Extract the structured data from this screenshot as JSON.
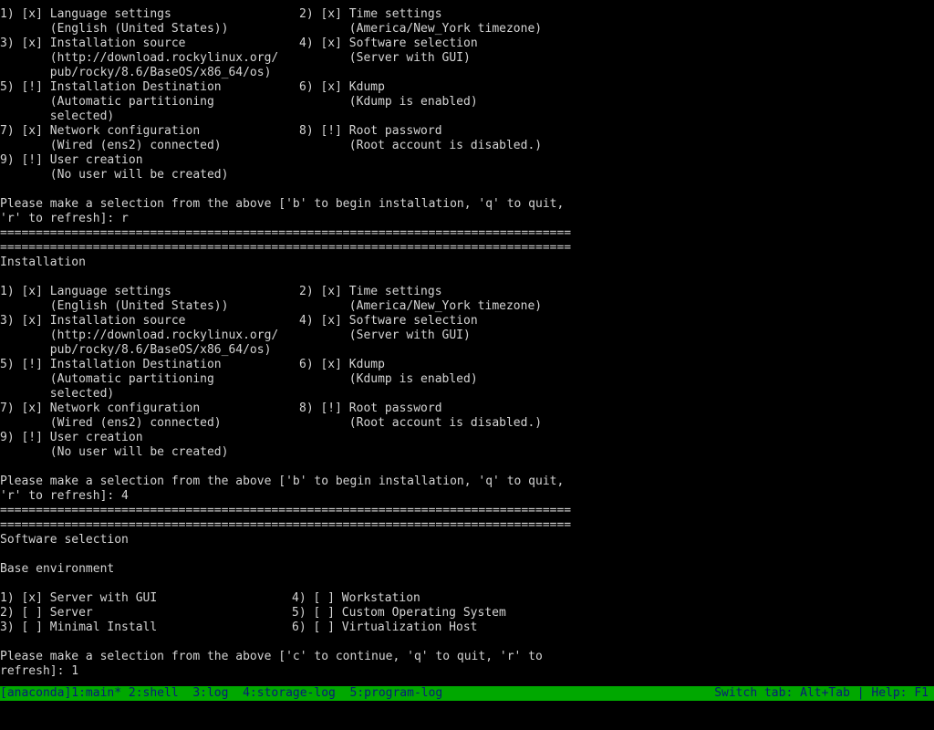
{
  "hub1": {
    "left": [
      "1) [x] Language settings",
      "       (English (United States))",
      "3) [x] Installation source",
      "       (http://download.rockylinux.org/",
      "       pub/rocky/8.6/BaseOS/x86_64/os)",
      "5) [!] Installation Destination",
      "       (Automatic partitioning",
      "       selected)",
      "7) [x] Network configuration",
      "       (Wired (ens2) connected)",
      "9) [!] User creation",
      "       (No user will be created)"
    ],
    "right": [
      "2) [x] Time settings",
      "       (America/New_York timezone)",
      "4) [x] Software selection",
      "       (Server with GUI)",
      "",
      "6) [x] Kdump",
      "       (Kdump is enabled)",
      "",
      "8) [!] Root password",
      "       (Root account is disabled.)",
      "",
      ""
    ],
    "prompt1": "Please make a selection from the above ['b' to begin installation, 'q' to quit,",
    "prompt2": "'r' to refresh]: r"
  },
  "separator": "================================================================================",
  "hub2": {
    "title": "Installation",
    "left": [
      "1) [x] Language settings",
      "       (English (United States))",
      "3) [x] Installation source",
      "       (http://download.rockylinux.org/",
      "       pub/rocky/8.6/BaseOS/x86_64/os)",
      "5) [!] Installation Destination",
      "       (Automatic partitioning",
      "       selected)",
      "7) [x] Network configuration",
      "       (Wired (ens2) connected)",
      "9) [!] User creation",
      "       (No user will be created)"
    ],
    "right": [
      "2) [x] Time settings",
      "       (America/New_York timezone)",
      "4) [x] Software selection",
      "       (Server with GUI)",
      "",
      "6) [x] Kdump",
      "       (Kdump is enabled)",
      "",
      "8) [!] Root password",
      "       (Root account is disabled.)",
      "",
      ""
    ],
    "prompt1": "Please make a selection from the above ['b' to begin installation, 'q' to quit,",
    "prompt2": "'r' to refresh]: 4"
  },
  "software": {
    "title": "Software selection",
    "subtitle": "Base environment",
    "left": [
      "1) [x] Server with GUI",
      "2) [ ] Server",
      "3) [ ] Minimal Install"
    ],
    "right": [
      "4) [ ] Workstation",
      "5) [ ] Custom Operating System",
      "6) [ ] Virtualization Host"
    ],
    "prompt1": "Please make a selection from the above ['c' to continue, 'q' to quit, 'r' to",
    "prompt2": "refresh]: 1"
  },
  "status_bar": {
    "tabs": "[anaconda]1:main* 2:shell  3:log  4:storage-log  5:program-log",
    "help": "Switch tab: Alt+Tab | Help: F1",
    "bg_color": "#00a800",
    "fg_color": "#0a1a7a"
  }
}
